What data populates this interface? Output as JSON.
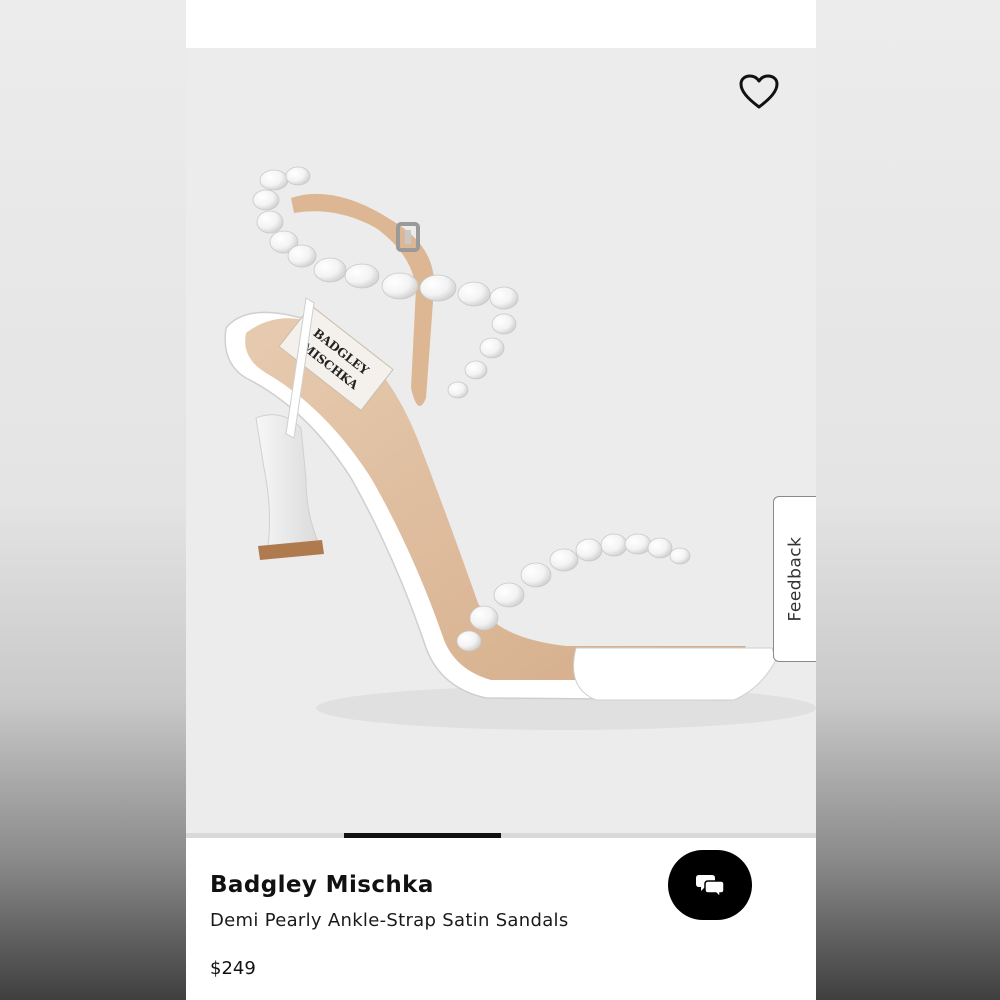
{
  "product": {
    "brand": "Badgley Mischka",
    "name": "Demi Pearly Ankle-Strap Satin Sandals",
    "price": "$249",
    "image_insole_logo": "BADGLEY MISCHKA"
  },
  "feedback_tab": {
    "label": "Feedback"
  },
  "carousel": {
    "total_slides": 4,
    "active_slide": 2
  },
  "icons": {
    "wishlist": "heart-icon",
    "chat": "chat-bubbles-icon"
  },
  "colors": {
    "image_background": "#ececec",
    "indicator_active": "#111111",
    "indicator_track": "#d9d9d9",
    "chat_button": "#000000"
  }
}
